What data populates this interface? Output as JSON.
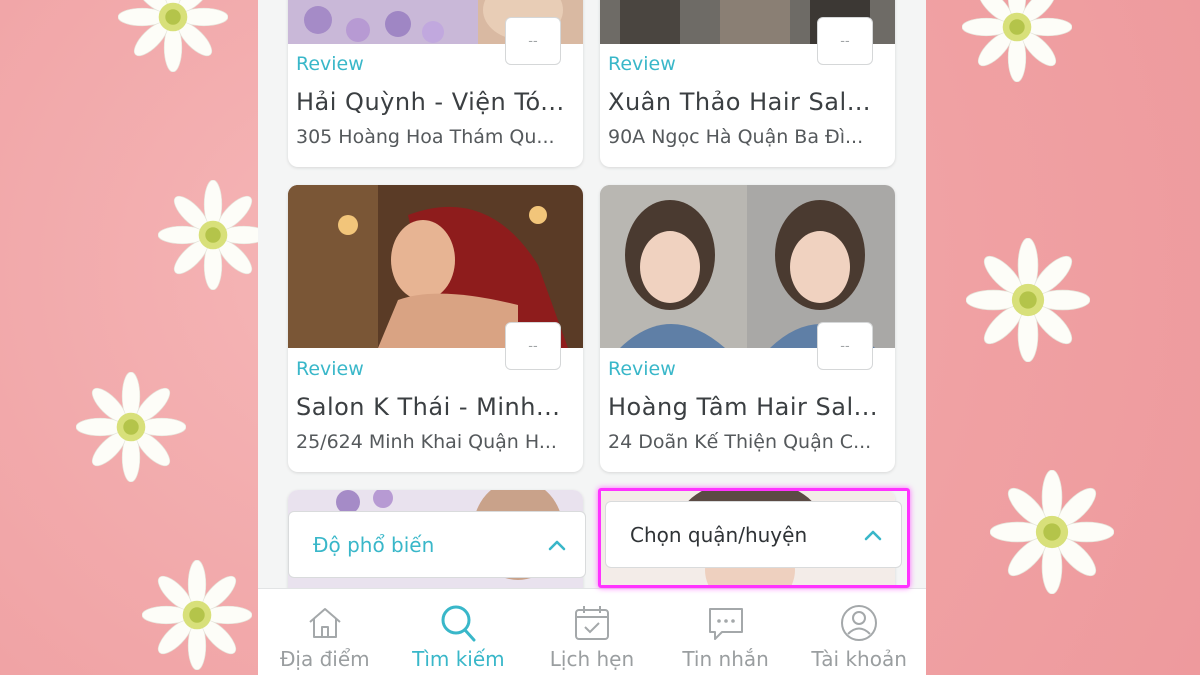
{
  "cards": [
    {
      "review_label": "Review",
      "name": "Hải Quỳnh - Viện Tó...",
      "address": "305 Hoàng Hoa Thám Qu...",
      "rating": "--"
    },
    {
      "review_label": "Review",
      "name": "Xuân Thảo Hair Salo...",
      "address": "90A Ngọc Hà Quận Ba Đì...",
      "rating": "--"
    },
    {
      "review_label": "Review",
      "name": "Salon K Thái - Minh...",
      "address": "25/624 Minh Khai Quận H...",
      "rating": "--"
    },
    {
      "review_label": "Review",
      "name": "Hoàng Tâm Hair Sal...",
      "address": "24 Doãn Kế Thiện Quận C...",
      "rating": "--"
    }
  ],
  "filters": {
    "sort_label": "Độ phổ biến",
    "district_label": "Chọn quận/huyện"
  },
  "tabs": [
    {
      "label": "Địa điểm",
      "icon": "home-icon",
      "active": false
    },
    {
      "label": "Tìm kiếm",
      "icon": "search-icon",
      "active": true
    },
    {
      "label": "Lịch hẹn",
      "icon": "calendar-icon",
      "active": false
    },
    {
      "label": "Tin nhắn",
      "icon": "chat-icon",
      "active": false
    },
    {
      "label": "Tài khoản",
      "icon": "user-icon",
      "active": false
    }
  ],
  "colors": {
    "accent": "#39b7c9",
    "highlight": "#ff33ff",
    "background": "#f2a9ab"
  }
}
